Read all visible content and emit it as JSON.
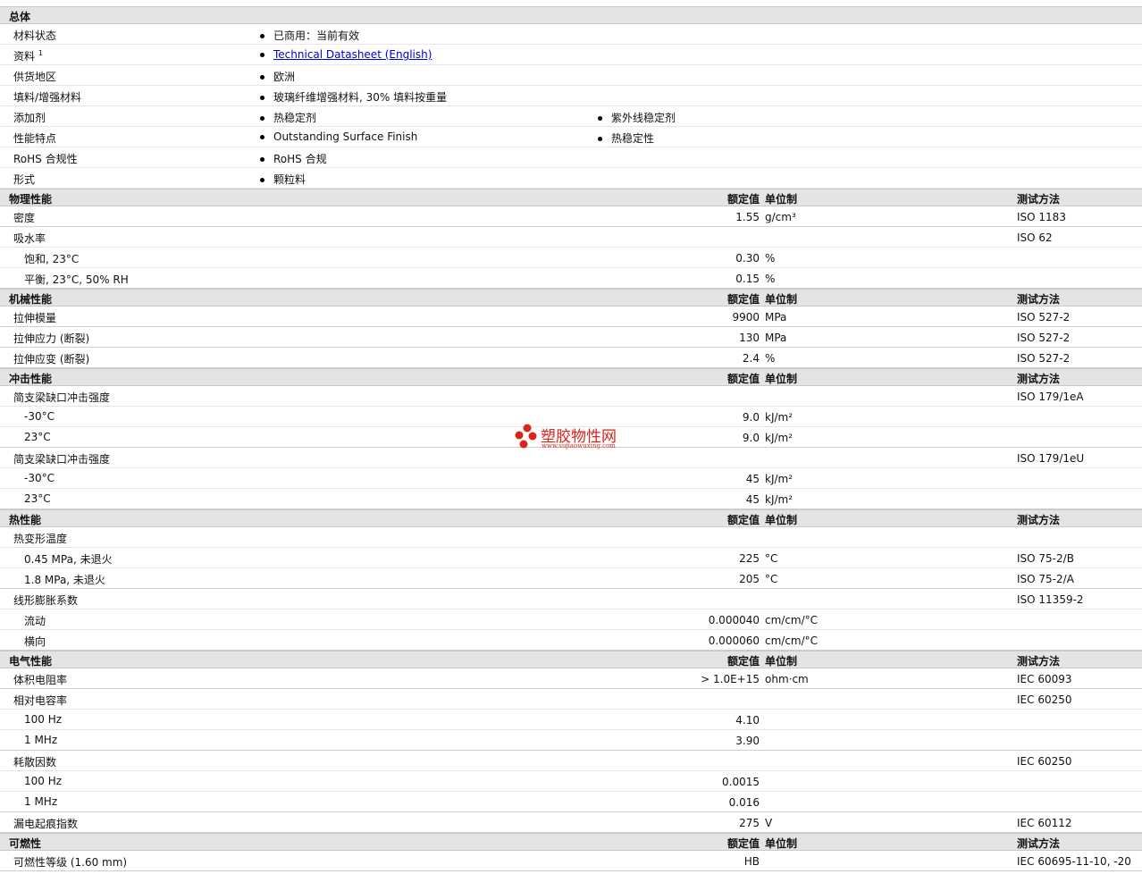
{
  "general": {
    "title": "总体",
    "rows": [
      {
        "label": "材料状态",
        "items": [
          "已商用：当前有效"
        ]
      },
      {
        "label": "资料",
        "sup": "1",
        "link": "Technical Datasheet (English)"
      },
      {
        "label": "供货地区",
        "items": [
          "欧洲"
        ]
      },
      {
        "label": "填料/增强材料",
        "items": [
          "玻璃纤维增强材料, 30% 填料按重量"
        ]
      },
      {
        "label": "添加剂",
        "items": [
          "热稳定剂",
          "紫外线稳定剂"
        ]
      },
      {
        "label": "性能特点",
        "items": [
          "Outstanding Surface Finish",
          "热稳定性"
        ]
      },
      {
        "label": "RoHS 合规性",
        "items": [
          "RoHS 合规"
        ]
      },
      {
        "label": "形式",
        "items": [
          "颗粒料"
        ]
      }
    ]
  },
  "col_headers": {
    "nominal": "额定值",
    "unit": "单位制",
    "method": "测试方法"
  },
  "sections": [
    {
      "title": "物理性能",
      "rows": [
        {
          "label": "密度",
          "value": "1.55",
          "unit": "g/cm³",
          "method": "ISO 1183"
        },
        {
          "label": "吸水率",
          "method": "ISO 62"
        },
        {
          "label": "饱和, 23°C",
          "value": "0.30",
          "unit": "%",
          "indent": true
        },
        {
          "label": "平衡, 23°C, 50% RH",
          "value": "0.15",
          "unit": "%",
          "indent": true
        }
      ]
    },
    {
      "title": "机械性能",
      "rows": [
        {
          "label": "拉伸模量",
          "value": "9900",
          "unit": "MPa",
          "method": "ISO 527-2"
        },
        {
          "label": "拉伸应力 (断裂)",
          "value": "130",
          "unit": "MPa",
          "method": "ISO 527-2"
        },
        {
          "label": "拉伸应变 (断裂)",
          "value": "2.4",
          "unit": "%",
          "method": "ISO 527-2"
        }
      ]
    },
    {
      "title": "冲击性能",
      "rows": [
        {
          "label": "简支梁缺口冲击强度",
          "method": "ISO 179/1eA"
        },
        {
          "label": "-30°C",
          "value": "9.0",
          "unit": "kJ/m²",
          "indent": true
        },
        {
          "label": "23°C",
          "value": "9.0",
          "unit": "kJ/m²",
          "indent": true
        },
        {
          "label": "简支梁缺口冲击强度",
          "method": "ISO 179/1eU"
        },
        {
          "label": "-30°C",
          "value": "45",
          "unit": "kJ/m²",
          "indent": true
        },
        {
          "label": "23°C",
          "value": "45",
          "unit": "kJ/m²",
          "indent": true
        }
      ]
    },
    {
      "title": "热性能",
      "rows": [
        {
          "label": "热变形温度"
        },
        {
          "label": "0.45 MPa, 未退火",
          "value": "225",
          "unit": "°C",
          "method": "ISO 75-2/B",
          "indent": true
        },
        {
          "label": "1.8 MPa, 未退火",
          "value": "205",
          "unit": "°C",
          "method": "ISO 75-2/A",
          "indent": true
        },
        {
          "label": "线形膨胀系数",
          "method": "ISO 11359-2"
        },
        {
          "label": "流动",
          "value": "0.000040",
          "unit": "cm/cm/°C",
          "indent": true
        },
        {
          "label": "横向",
          "value": "0.000060",
          "unit": "cm/cm/°C",
          "indent": true
        }
      ]
    },
    {
      "title": "电气性能",
      "rows": [
        {
          "label": "体积电阻率",
          "value": "> 1.0E+15",
          "unit": "ohm·cm",
          "method": "IEC 60093"
        },
        {
          "label": "相对电容率",
          "method": "IEC 60250"
        },
        {
          "label": "100 Hz",
          "value": "4.10",
          "indent": true
        },
        {
          "label": "1 MHz",
          "value": "3.90",
          "indent": true
        },
        {
          "label": "耗散因数",
          "method": "IEC 60250"
        },
        {
          "label": "100 Hz",
          "value": "0.0015",
          "indent": true
        },
        {
          "label": "1 MHz",
          "value": "0.016",
          "indent": true
        },
        {
          "label": "漏电起痕指数",
          "value": "275",
          "unit": "V",
          "method": "IEC 60112"
        }
      ]
    },
    {
      "title": "可燃性",
      "rows": [
        {
          "label": "可燃性等级 (1.60 mm)",
          "value": "HB",
          "method": "IEC 60695-11-10, -20"
        }
      ]
    }
  ],
  "watermark": {
    "name": "塑胶物性网",
    "url": "www.sujiaowuxing.com",
    "color": "#d9261c"
  }
}
